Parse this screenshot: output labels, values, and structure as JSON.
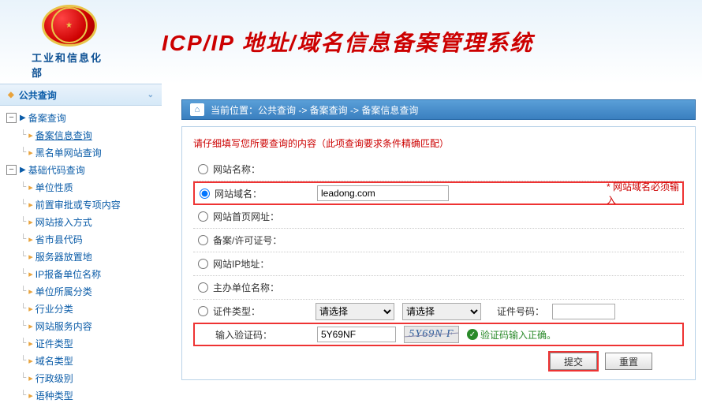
{
  "header": {
    "ministry": "工业和信息化部",
    "title": "ICP/IP 地址/域名信息备案管理系统"
  },
  "sidebar": {
    "section_title": "公共查询",
    "groups": [
      {
        "label": "备案查询",
        "children": [
          {
            "label": "备案信息查询",
            "selected": true
          },
          {
            "label": "黑名单网站查询"
          }
        ]
      },
      {
        "label": "基础代码查询",
        "children": [
          {
            "label": "单位性质"
          },
          {
            "label": "前置审批或专项内容"
          },
          {
            "label": "网站接入方式"
          },
          {
            "label": "省市县代码"
          },
          {
            "label": "服务器放置地"
          },
          {
            "label": "IP报备单位名称"
          },
          {
            "label": "单位所属分类"
          },
          {
            "label": "行业分类"
          },
          {
            "label": "网站服务内容"
          },
          {
            "label": "证件类型"
          },
          {
            "label": "域名类型"
          },
          {
            "label": "行政级别"
          },
          {
            "label": "语种类型"
          }
        ]
      }
    ]
  },
  "breadcrumb": {
    "prefix": "当前位置：",
    "parts": [
      "公共查询",
      "备案查询",
      "备案信息查询"
    ],
    "separator": " -> "
  },
  "form": {
    "instruction": "请仔细填写您所要查询的内容（此项查询要求条件精确匹配）",
    "rows": {
      "site_name": {
        "label": "网站名称：",
        "value": ""
      },
      "site_domain": {
        "label": "网站域名：",
        "value": "leadong.com",
        "required_note": "* 网站域名必须输入"
      },
      "home_url": {
        "label": "网站首页网址：",
        "value": ""
      },
      "license_no": {
        "label": "备案/许可证号：",
        "value": ""
      },
      "ip_addr": {
        "label": "网站IP地址：",
        "value": ""
      },
      "sponsor": {
        "label": "主办单位名称：",
        "value": ""
      },
      "cert_type": {
        "label": "证件类型：",
        "select1": "请选择",
        "select2": "请选择",
        "cert_no_label": "证件号码：",
        "cert_no_value": ""
      },
      "captcha": {
        "label": "输入验证码：",
        "value": "5Y69NF",
        "image_text": "5Y69N F",
        "valid_text": "验证码输入正确。"
      }
    },
    "buttons": {
      "submit": "提交",
      "reset": "重置"
    }
  }
}
